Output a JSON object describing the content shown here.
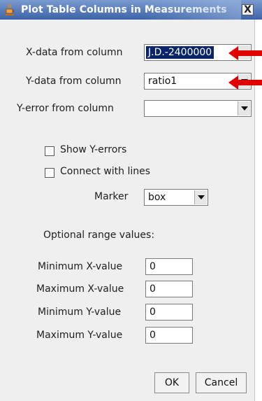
{
  "window": {
    "title": "Plot Table Columns in Measurements",
    "close_glyph": "X"
  },
  "fields": {
    "x_data": {
      "label": "X-data from column",
      "value": "J.D.-2400000"
    },
    "y_data": {
      "label": "Y-data from column",
      "value": "ratio1"
    },
    "y_error": {
      "label": "Y-error from column",
      "value": ""
    }
  },
  "options": {
    "show_y_errors": {
      "label": "Show Y-errors",
      "checked": false
    },
    "connect_with_lines": {
      "label": "Connect with lines",
      "checked": false
    },
    "marker": {
      "label": "Marker",
      "value": "box"
    }
  },
  "range": {
    "heading": "Optional range values:",
    "min_x": {
      "label": "Minimum X-value",
      "value": "0"
    },
    "max_x": {
      "label": "Maximum X-value",
      "value": "0"
    },
    "min_y": {
      "label": "Minimum Y-value",
      "value": "0"
    },
    "max_y": {
      "label": "Maximum Y-value",
      "value": "0"
    }
  },
  "buttons": {
    "ok": "OK",
    "cancel": "Cancel"
  },
  "colors": {
    "titlebar": "#3d63a8",
    "selection": "#0a246a",
    "arrow": "#e00000"
  },
  "icons": {
    "title": "java-cup-icon",
    "annotation": "red-arrow-icon"
  }
}
